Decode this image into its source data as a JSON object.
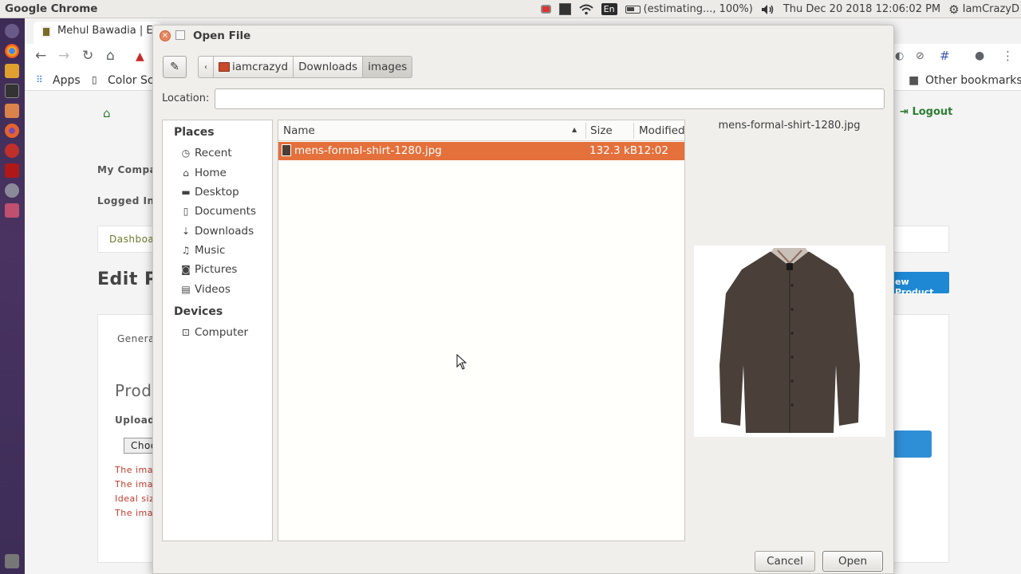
{
  "top_panel": {
    "app_name": "Google Chrome",
    "battery": "(estimating..., 100%)",
    "language": "En",
    "datetime": "Thu Dec 20 2018 12:06:02 PM",
    "user": "IamCrazyD"
  },
  "browser": {
    "tab_title": "Mehul Bawadia | Ec",
    "bookmarks": {
      "apps": "Apps",
      "color": "Color Sch",
      "other": "Other bookmarks"
    }
  },
  "page": {
    "my_company": "My Compar",
    "logged_in": "Logged In A",
    "dashboard": "Dashboa",
    "edit_title": "Edit Pr",
    "general_tab": "Genera",
    "prod_heading": "Prod",
    "upload_label": "Upload",
    "choose_btn": "Choo",
    "red_lines": [
      "The imag",
      "The imag",
      "Ideal size",
      "The imag"
    ],
    "logout": "Logout",
    "new_product": "ew Product"
  },
  "dialog": {
    "title": "Open File",
    "path": [
      "iamcrazyd",
      "Downloads",
      "images"
    ],
    "location_label": "Location:",
    "location_value": "",
    "places_heading": "Places",
    "places": [
      {
        "label": "Recent",
        "icon": "clock-icon"
      },
      {
        "label": "Home",
        "icon": "home-icon"
      },
      {
        "label": "Desktop",
        "icon": "folder-icon"
      },
      {
        "label": "Documents",
        "icon": "document-icon"
      },
      {
        "label": "Downloads",
        "icon": "download-icon"
      },
      {
        "label": "Music",
        "icon": "music-icon"
      },
      {
        "label": "Pictures",
        "icon": "camera-icon"
      },
      {
        "label": "Videos",
        "icon": "film-icon"
      }
    ],
    "devices_heading": "Devices",
    "devices": [
      {
        "label": "Computer",
        "icon": "computer-icon"
      }
    ],
    "columns": {
      "name": "Name",
      "size": "Size",
      "modified": "Modified"
    },
    "files": [
      {
        "name": "mens-formal-shirt-1280.jpg",
        "size": "132.3 kB",
        "modified": "12:02",
        "selected": true
      }
    ],
    "preview_filename": "mens-formal-shirt-1280.jpg",
    "cancel": "Cancel",
    "open": "Open"
  },
  "colors": {
    "selection": "#e4703b",
    "launcher": "#3d2b55",
    "accent_green": "#2e7d32"
  }
}
